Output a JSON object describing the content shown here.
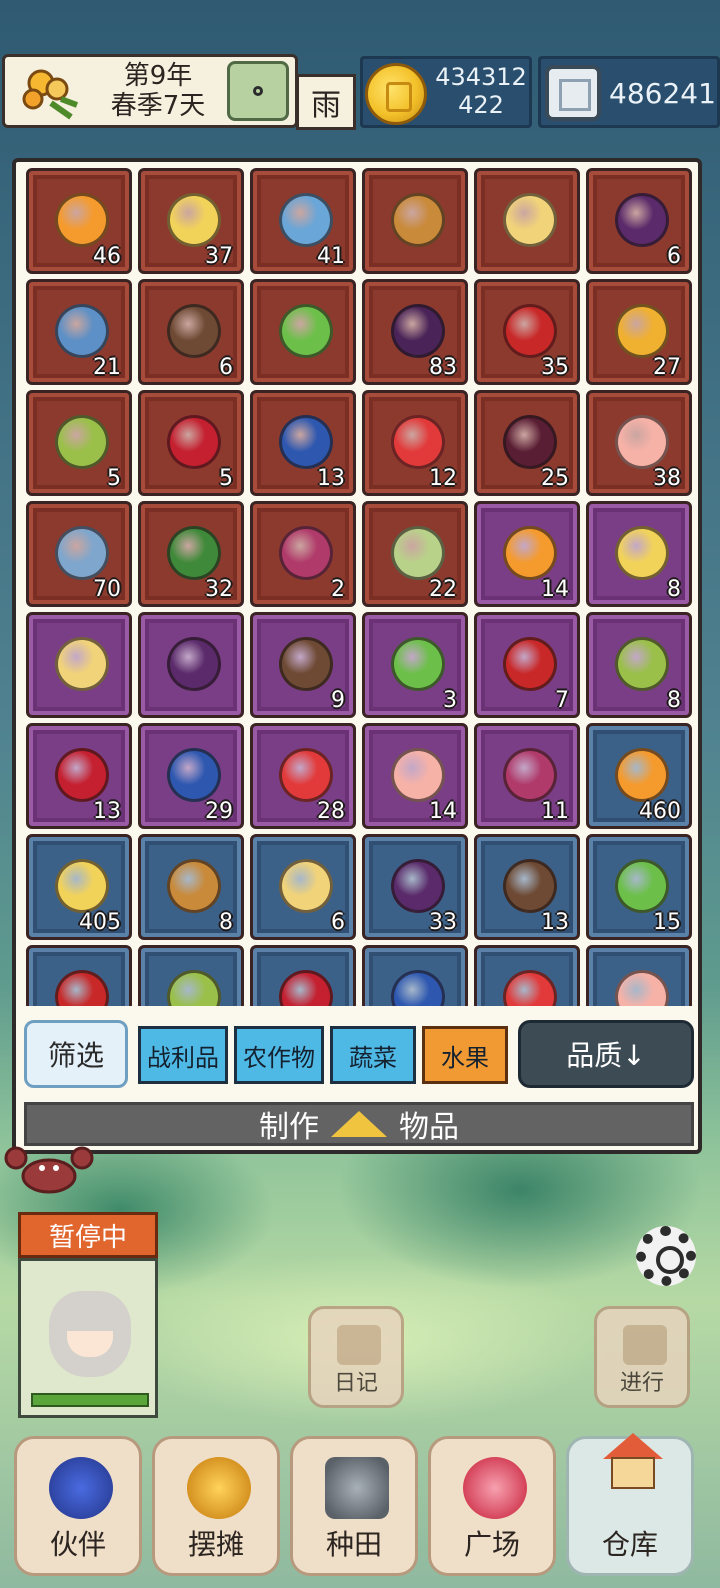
{
  "header": {
    "year": "第9年",
    "season_day": "春季7天",
    "weather": "雨",
    "coins_line1": "434312",
    "coins_line2": "422",
    "gems": "486241"
  },
  "inventory": {
    "items": [
      {
        "name": "orange",
        "count": "46",
        "rarity": "red",
        "color": "#f59b2e"
      },
      {
        "name": "pear",
        "count": "37",
        "rarity": "red",
        "color": "#f2d35a"
      },
      {
        "name": "blue-banana",
        "count": "41",
        "rarity": "red",
        "color": "#6aa6d8"
      },
      {
        "name": "kiwi",
        "count": "",
        "rarity": "red",
        "color": "#c98a3a"
      },
      {
        "name": "mango",
        "count": "",
        "rarity": "red",
        "color": "#f1d37a"
      },
      {
        "name": "grape",
        "count": "6",
        "rarity": "red",
        "color": "#5a2a6a"
      },
      {
        "name": "blue-fruit",
        "count": "21",
        "rarity": "red",
        "color": "#5c90c6"
      },
      {
        "name": "coconut",
        "count": "6",
        "rarity": "red",
        "color": "#6e4a34"
      },
      {
        "name": "green-grape",
        "count": "",
        "rarity": "red",
        "color": "#6cc04a"
      },
      {
        "name": "plum",
        "count": "83",
        "rarity": "red",
        "color": "#4a2458"
      },
      {
        "name": "apple",
        "count": "35",
        "rarity": "red",
        "color": "#c82828"
      },
      {
        "name": "pineapple",
        "count": "27",
        "rarity": "red",
        "color": "#f0b030"
      },
      {
        "name": "sugarcane",
        "count": "5",
        "rarity": "red",
        "color": "#9ac04a"
      },
      {
        "name": "cherry",
        "count": "5",
        "rarity": "red",
        "color": "#c42030"
      },
      {
        "name": "blueberry",
        "count": "13",
        "rarity": "red",
        "color": "#2e58b0"
      },
      {
        "name": "strawberry",
        "count": "12",
        "rarity": "red",
        "color": "#e23a3a"
      },
      {
        "name": "mangosteen",
        "count": "25",
        "rarity": "red",
        "color": "#5a1e34"
      },
      {
        "name": "peach",
        "count": "38",
        "rarity": "red",
        "color": "#f7b2a8"
      },
      {
        "name": "starfruit",
        "count": "70",
        "rarity": "red",
        "color": "#7fa6cc"
      },
      {
        "name": "watermelon",
        "count": "32",
        "rarity": "red",
        "color": "#3f8a3a"
      },
      {
        "name": "lychee",
        "count": "2",
        "rarity": "red",
        "color": "#b03a6a"
      },
      {
        "name": "melon",
        "count": "22",
        "rarity": "red",
        "color": "#b9d28a"
      },
      {
        "name": "orange",
        "count": "14",
        "rarity": "purple",
        "color": "#f59b2e"
      },
      {
        "name": "pear",
        "count": "8",
        "rarity": "purple",
        "color": "#f2d35a"
      },
      {
        "name": "mango",
        "count": "",
        "rarity": "purple",
        "color": "#f1d37a"
      },
      {
        "name": "grape",
        "count": "",
        "rarity": "purple",
        "color": "#5a2a6a"
      },
      {
        "name": "coconut",
        "count": "9",
        "rarity": "purple",
        "color": "#6e4a34"
      },
      {
        "name": "green-grape",
        "count": "3",
        "rarity": "purple",
        "color": "#6cc04a"
      },
      {
        "name": "apple",
        "count": "7",
        "rarity": "purple",
        "color": "#c82828"
      },
      {
        "name": "sugarcane",
        "count": "8",
        "rarity": "purple",
        "color": "#9ac04a"
      },
      {
        "name": "cherry",
        "count": "13",
        "rarity": "purple",
        "color": "#c42030"
      },
      {
        "name": "blueberry",
        "count": "29",
        "rarity": "purple",
        "color": "#2e58b0"
      },
      {
        "name": "strawberry",
        "count": "28",
        "rarity": "purple",
        "color": "#e23a3a"
      },
      {
        "name": "peach",
        "count": "14",
        "rarity": "purple",
        "color": "#f7b2a8"
      },
      {
        "name": "lychee",
        "count": "11",
        "rarity": "purple",
        "color": "#b03a6a"
      },
      {
        "name": "orange",
        "count": "460",
        "rarity": "blue",
        "color": "#f59b2e"
      },
      {
        "name": "pear",
        "count": "405",
        "rarity": "blue",
        "color": "#f2d35a"
      },
      {
        "name": "kiwi",
        "count": "8",
        "rarity": "blue",
        "color": "#c98a3a"
      },
      {
        "name": "mango",
        "count": "6",
        "rarity": "blue",
        "color": "#f1d37a"
      },
      {
        "name": "grape",
        "count": "33",
        "rarity": "blue",
        "color": "#5a2a6a"
      },
      {
        "name": "coconut",
        "count": "13",
        "rarity": "blue",
        "color": "#6e4a34"
      },
      {
        "name": "green-grape",
        "count": "15",
        "rarity": "blue",
        "color": "#6cc04a"
      },
      {
        "name": "apple",
        "count": "",
        "rarity": "blue",
        "color": "#c82828"
      },
      {
        "name": "sugarcane",
        "count": "",
        "rarity": "blue",
        "color": "#9ac04a"
      },
      {
        "name": "cherry",
        "count": "",
        "rarity": "blue",
        "color": "#c42030"
      },
      {
        "name": "blueberry",
        "count": "",
        "rarity": "blue",
        "color": "#2e58b0"
      },
      {
        "name": "strawberry",
        "count": "",
        "rarity": "blue",
        "color": "#e23a3a"
      },
      {
        "name": "peach",
        "count": "",
        "rarity": "blue",
        "color": "#f7b2a8"
      }
    ]
  },
  "filters": {
    "filter_label": "筛选",
    "categories": [
      "战利品",
      "农作物",
      "蔬菜",
      "水果"
    ],
    "active_category": "水果",
    "sort_label": "品质↓"
  },
  "craft": {
    "left": "制作",
    "right": "物品"
  },
  "companion": {
    "status": "暂停中",
    "stamina_fraction": 1.0
  },
  "side_buttons": {
    "diary": "日记",
    "proceed": "进行"
  },
  "nav": {
    "partner": "伙伴",
    "stall": "摆摊",
    "farm": "种田",
    "plaza": "广场",
    "warehouse": "仓库"
  }
}
